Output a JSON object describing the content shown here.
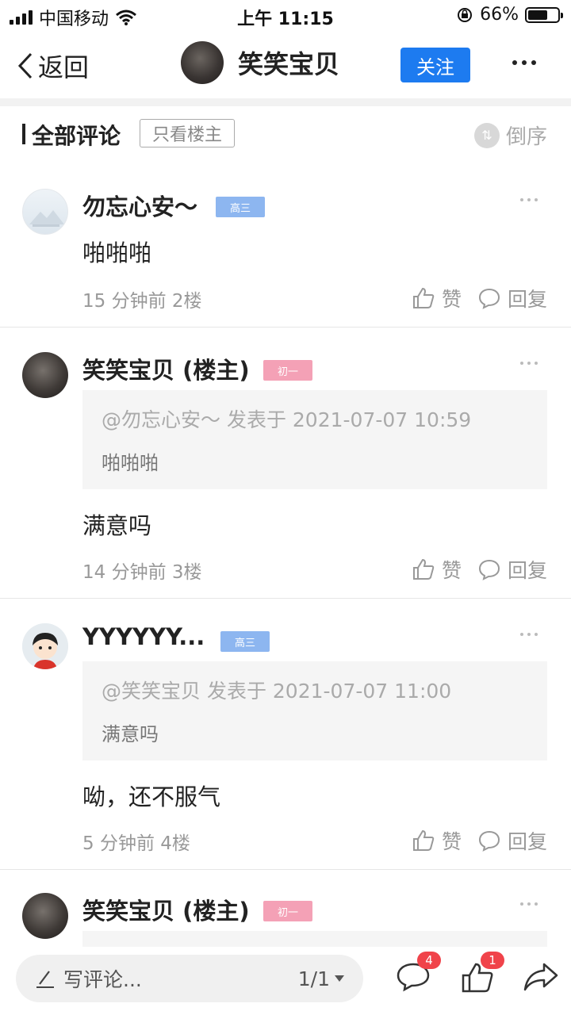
{
  "status_bar": {
    "carrier": "中国移动",
    "time": "上午 11:15",
    "battery": "66%",
    "battery_level": 0.66
  },
  "nav": {
    "back_label": "返回",
    "title": "笑笑宝贝",
    "follow_label": "关注"
  },
  "filter": {
    "title": "全部评论",
    "only_host_label": "只看楼主",
    "sort_label": "倒序"
  },
  "comments": [
    {
      "name": "勿忘心安～",
      "grade": "高三",
      "text": "啪啪啪",
      "time": "15 分钟前",
      "floor": "2楼",
      "like_label": "赞",
      "reply_label": "回复"
    },
    {
      "name": "笑笑宝贝 (楼主)",
      "grade": "初一",
      "quote_head": "@勿忘心安～ 发表于 2021-07-07 10:59",
      "quote_text": "啪啪啪",
      "text": "满意吗",
      "time": "14 分钟前",
      "floor": "3楼",
      "like_label": "赞",
      "reply_label": "回复"
    },
    {
      "name": "YYYYYY...",
      "grade": "高三",
      "quote_head": "@笑笑宝贝 发表于 2021-07-07 11:00",
      "quote_text": "满意吗",
      "text": "呦，还不服气",
      "time": "5 分钟前",
      "floor": "4楼",
      "like_label": "赞",
      "reply_label": "回复"
    },
    {
      "name": "笑笑宝贝 (楼主)",
      "grade": "初一"
    }
  ],
  "bottom": {
    "write_placeholder": "写评论...",
    "page": "1/1",
    "comment_count": "4",
    "like_count": "1"
  },
  "colors": {
    "accent": "#1d7bf0",
    "tag_blue": "#8db6f0",
    "tag_pink": "#f4a1b6",
    "badge_red": "#f0434a"
  }
}
